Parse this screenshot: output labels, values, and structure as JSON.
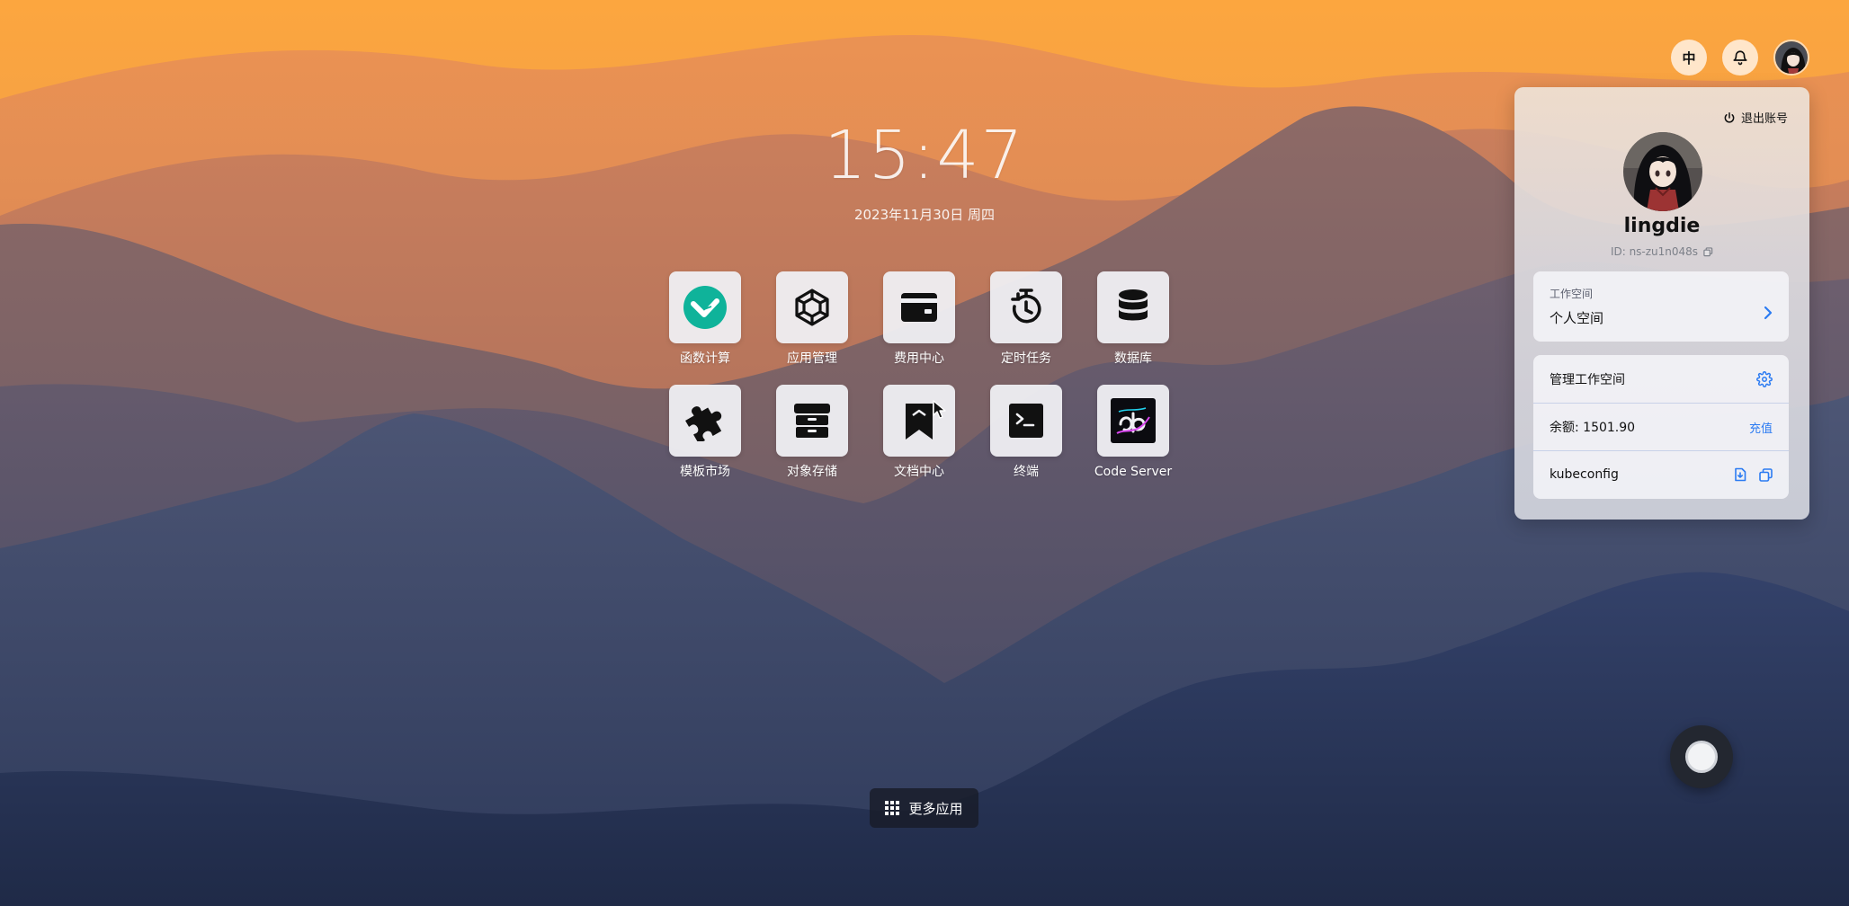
{
  "clock": {
    "time": "15:47",
    "date": "2023年11月30日 周四"
  },
  "apps": [
    {
      "label": "函数计算",
      "icon": "laf-icon"
    },
    {
      "label": "应用管理",
      "icon": "app-manage-icon"
    },
    {
      "label": "费用中心",
      "icon": "wallet-icon"
    },
    {
      "label": "定时任务",
      "icon": "timer-icon"
    },
    {
      "label": "数据库",
      "icon": "database-icon"
    },
    {
      "label": "模板市场",
      "icon": "puzzle-icon"
    },
    {
      "label": "对象存储",
      "icon": "archive-icon"
    },
    {
      "label": "文档中心",
      "icon": "bookmark-icon"
    },
    {
      "label": "终端",
      "icon": "terminal-icon"
    },
    {
      "label": "Code Server",
      "icon": "code-server-icon"
    }
  ],
  "more_apps": {
    "label": "更多应用"
  },
  "topbar": {
    "language": "中",
    "notifications_icon": "bell-icon"
  },
  "profile": {
    "logout_label": "退出账号",
    "username": "lingdie",
    "id_text": "ID: ns-zu1n048s",
    "workspace": {
      "label": "工作空间",
      "value": "个人空间"
    },
    "manage_workspace": "管理工作空间",
    "balance": "余额: 1501.90",
    "recharge": "充值",
    "kubeconfig": "kubeconfig"
  },
  "colors": {
    "accent": "#2b7bf2",
    "laf_green": "#0fb39a",
    "panel_text": "#111111"
  }
}
